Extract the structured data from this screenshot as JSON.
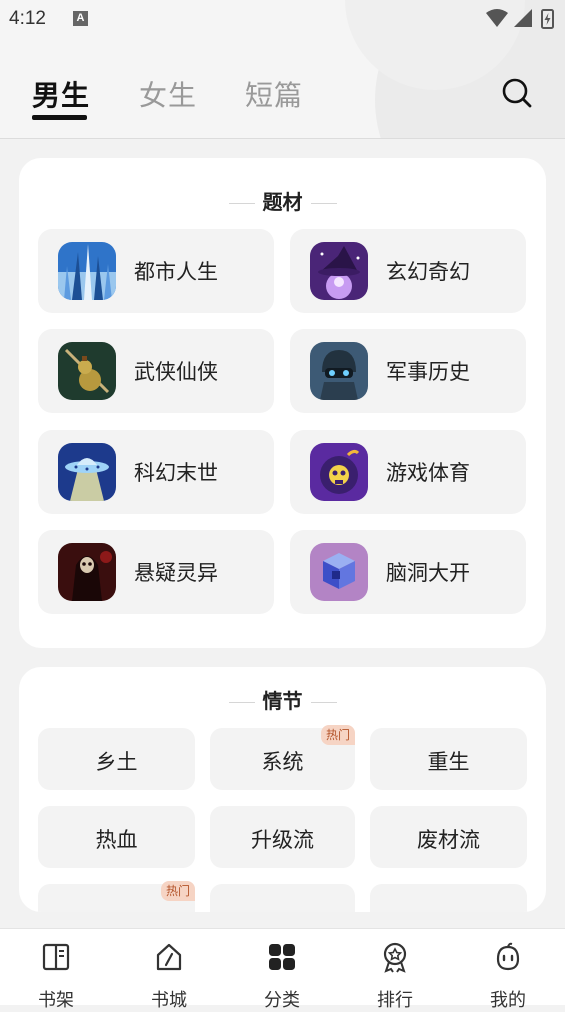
{
  "status_bar": {
    "time": "4:12",
    "notification_icon": "A"
  },
  "tabs": [
    {
      "label": "男生",
      "active": true
    },
    {
      "label": "女生",
      "active": false
    },
    {
      "label": "短篇",
      "active": false
    }
  ],
  "genres": {
    "title": "题材",
    "items": [
      {
        "label": "都市人生",
        "icon": "city-skyscraper-icon"
      },
      {
        "label": "玄幻奇幻",
        "icon": "wizard-icon"
      },
      {
        "label": "武侠仙侠",
        "icon": "gourd-sword-icon"
      },
      {
        "label": "军事历史",
        "icon": "soldier-helmet-icon"
      },
      {
        "label": "科幻末世",
        "icon": "ufo-icon"
      },
      {
        "label": "游戏体育",
        "icon": "skull-bomb-icon"
      },
      {
        "label": "悬疑灵异",
        "icon": "grim-reaper-icon"
      },
      {
        "label": "脑洞大开",
        "icon": "cubes-icon"
      }
    ]
  },
  "plots": {
    "title": "情节",
    "items": [
      {
        "label": "乡土",
        "badge": ""
      },
      {
        "label": "系统",
        "badge": "热门"
      },
      {
        "label": "重生",
        "badge": ""
      },
      {
        "label": "热血",
        "badge": ""
      },
      {
        "label": "升级流",
        "badge": ""
      },
      {
        "label": "废材流",
        "badge": ""
      }
    ],
    "partial_badge": "热门"
  },
  "bottom_nav": [
    {
      "label": "书架",
      "icon": "bookshelf-icon",
      "active": false
    },
    {
      "label": "书城",
      "icon": "bookstore-icon",
      "active": false
    },
    {
      "label": "分类",
      "icon": "category-grid-icon",
      "active": true
    },
    {
      "label": "排行",
      "icon": "ranking-medal-icon",
      "active": false
    },
    {
      "label": "我的",
      "icon": "profile-face-icon",
      "active": false
    }
  ]
}
